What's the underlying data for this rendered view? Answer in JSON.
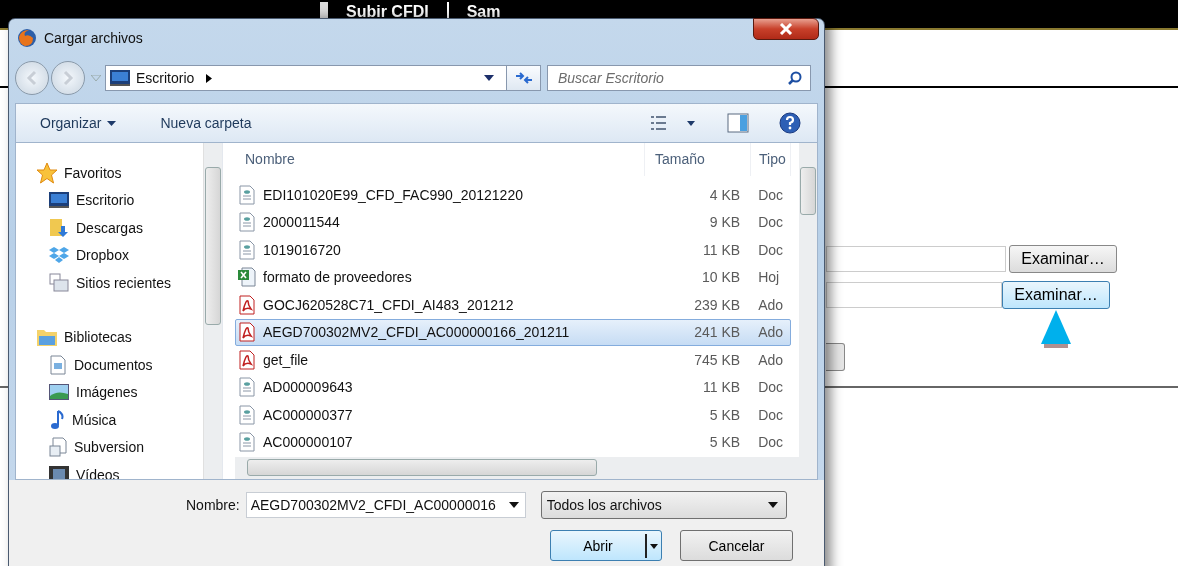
{
  "background_page": {
    "menu": [
      "Subir CFDI",
      "Sam"
    ],
    "file_inputs": [
      {
        "button": "Examinar…",
        "focused": false
      },
      {
        "button": "Examinar…",
        "focused": true
      }
    ]
  },
  "dialog": {
    "title": "Cargar archivos",
    "address": "Escritorio",
    "search": {
      "placeholder": "Buscar Escritorio"
    },
    "toolbar": [
      "Organizar",
      "Nueva carpeta"
    ],
    "sidebar": [
      {
        "label": "Favoritos",
        "children": [
          {
            "label": "Escritorio"
          },
          {
            "label": "Descargas"
          },
          {
            "label": "Dropbox"
          },
          {
            "label": "Sitios recientes"
          }
        ]
      },
      {
        "label": "Bibliotecas",
        "children": [
          {
            "label": "Documentos"
          },
          {
            "label": "Imágenes"
          },
          {
            "label": "Música"
          },
          {
            "label": "Subversion"
          },
          {
            "label": "Vídeos"
          }
        ]
      }
    ],
    "columns": [
      "Nombre",
      "Tamaño",
      "Tipo"
    ],
    "rows": [
      {
        "name": "EDI101020E99_CFD_FAC990_20121220",
        "size": "4 KB",
        "type": "Doc",
        "kind": "document",
        "selected": false
      },
      {
        "name": "2000011544",
        "size": "9 KB",
        "type": "Doc",
        "kind": "document",
        "selected": false
      },
      {
        "name": "1019016720",
        "size": "11 KB",
        "type": "Doc",
        "kind": "document",
        "selected": false
      },
      {
        "name": "formato de proveedores",
        "size": "10 KB",
        "type": "Hoj",
        "kind": "spreadsheet",
        "selected": false
      },
      {
        "name": "GOCJ620528C71_CFDI_AI483_201212",
        "size": "239 KB",
        "type": "Ado",
        "kind": "pdf",
        "selected": false
      },
      {
        "name": "AEGD700302MV2_CFDI_AC000000166_201211",
        "size": "241 KB",
        "type": "Ado",
        "kind": "pdf",
        "selected": true
      },
      {
        "name": "get_file",
        "size": "745 KB",
        "type": "Ado",
        "kind": "pdf",
        "selected": false
      },
      {
        "name": "AD000009643",
        "size": "11 KB",
        "type": "Doc",
        "kind": "document",
        "selected": false
      },
      {
        "name": "AC000000377",
        "size": "5 KB",
        "type": "Doc",
        "kind": "document",
        "selected": false
      },
      {
        "name": "AC000000107",
        "size": "5 KB",
        "type": "Doc",
        "kind": "document",
        "selected": false
      }
    ],
    "filename_label": "Nombre:",
    "filename": "AEGD700302MV2_CFDI_AC00000016",
    "filetype": "Todos los archivos",
    "buttons": [
      "Abrir",
      "Cancelar"
    ]
  }
}
